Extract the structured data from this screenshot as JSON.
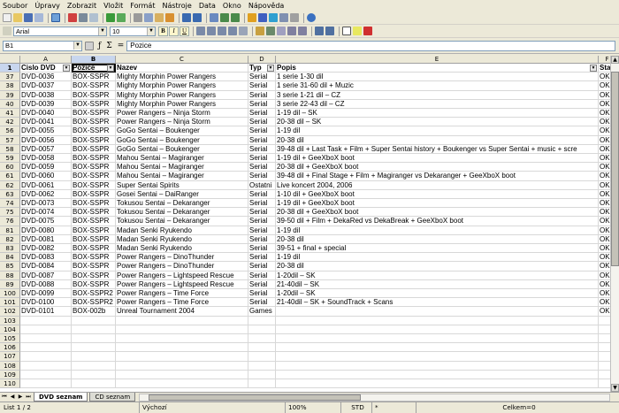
{
  "menu": [
    "Soubor",
    "Úpravy",
    "Zobrazit",
    "Vložit",
    "Formát",
    "Nástroje",
    "Data",
    "Okno",
    "Nápověda"
  ],
  "format_toolbar": {
    "font_name": "Arial",
    "font_size": "10",
    "bold": "B",
    "italic": "I",
    "underline": "U"
  },
  "formula_bar": {
    "cell_ref": "B1",
    "fx_symbol": "ƒ",
    "sum_symbol": "Σ",
    "eq_symbol": "=",
    "content": "Pozice"
  },
  "columns": [
    "A",
    "B",
    "C",
    "D",
    "E",
    "F"
  ],
  "header_row": {
    "row_num": "1",
    "cells": [
      "Cislo DVD",
      "Pozice",
      "Nazev",
      "Typ",
      "Popis",
      "Sta"
    ]
  },
  "rows": [
    {
      "n": "37",
      "c": [
        "DVD-0036",
        "BOX-SSPR",
        "Mighty Morphin Power Rangers",
        "Serial",
        "1 serie 1-30 dil",
        "OK"
      ]
    },
    {
      "n": "38",
      "c": [
        "DVD-0037",
        "BOX-SSPR",
        "Mighty Morphin Power Rangers",
        "Serial",
        "1 serie 31-60 dil + Muzic",
        "OK"
      ]
    },
    {
      "n": "39",
      "c": [
        "DVD-0038",
        "BOX-SSPR",
        "Mighty Morphin Power Rangers",
        "Serial",
        "3 serie 1-21 dil – CZ",
        "OK"
      ]
    },
    {
      "n": "40",
      "c": [
        "DVD-0039",
        "BOX-SSPR",
        "Mighty Morphin Power Rangers",
        "Serial",
        "3 serie 22-43 dil – CZ",
        "OK"
      ]
    },
    {
      "n": "41",
      "c": [
        "DVD-0040",
        "BOX-SSPR",
        "Power Rangers – Ninja Storm",
        "Serial",
        "1-19 dil – SK",
        "OK"
      ]
    },
    {
      "n": "42",
      "c": [
        "DVD-0041",
        "BOX-SSPR",
        "Power Rangers – Ninja Storm",
        "Serial",
        "20-38 dil – SK",
        "OK"
      ]
    },
    {
      "n": "56",
      "c": [
        "DVD-0055",
        "BOX-SSPR",
        "GoGo Sentai – Boukenger",
        "Serial",
        "1-19 dil",
        "OK"
      ]
    },
    {
      "n": "57",
      "c": [
        "DVD-0056",
        "BOX-SSPR",
        "GoGo Sentai – Boukenger",
        "Serial",
        "20-38 dil",
        "OK"
      ]
    },
    {
      "n": "58",
      "c": [
        "DVD-0057",
        "BOX-SSPR",
        "GoGo Sentai – Boukenger",
        "Serial",
        "39-48 dil + Last Task + Film + Super Sentai history + Boukenger vs Super Sentai + music + scre",
        "OK"
      ]
    },
    {
      "n": "59",
      "c": [
        "DVD-0058",
        "BOX-SSPR",
        "Mahou Sentai – Magiranger",
        "Serial",
        "1-19 dil + GeeXboX boot",
        "OK"
      ]
    },
    {
      "n": "60",
      "c": [
        "DVD-0059",
        "BOX-SSPR",
        "Mahou Sentai – Magiranger",
        "Serial",
        "20-38 dil + GeeXboX boot",
        "OK"
      ]
    },
    {
      "n": "61",
      "c": [
        "DVD-0060",
        "BOX-SSPR",
        "Mahou Sentai – Magiranger",
        "Serial",
        "39-48 dil + Final Stage + Film + Magiranger vs Dekaranger + GeeXboX boot",
        "OK"
      ]
    },
    {
      "n": "62",
      "c": [
        "DVD-0061",
        "BOX-SSPR",
        "Super Sentai Spirits",
        "Ostatni",
        "Live koncert 2004, 2006",
        "OK"
      ]
    },
    {
      "n": "63",
      "c": [
        "DVD-0062",
        "BOX-SSPR",
        "Gosei Sentai – DaiRanger",
        "Serial",
        "1-10 dil + GeeXboX boot",
        "OK"
      ]
    },
    {
      "n": "74",
      "c": [
        "DVD-0073",
        "BOX-SSPR",
        "Tokusou Sentai – Dekaranger",
        "Serial",
        "1-19 dil + GeeXboX boot",
        "OK"
      ]
    },
    {
      "n": "75",
      "c": [
        "DVD-0074",
        "BOX-SSPR",
        "Tokusou Sentai – Dekaranger",
        "Serial",
        "20-38 dil + GeeXboX boot",
        "OK"
      ]
    },
    {
      "n": "76",
      "c": [
        "DVD-0075",
        "BOX-SSPR",
        "Tokusou Sentai – Dekaranger",
        "Serial",
        "39-50 dil + Film + DekaRed vs DekaBreak + GeeXboX boot",
        "OK"
      ]
    },
    {
      "n": "81",
      "c": [
        "DVD-0080",
        "BOX-SSPR",
        "Madan Senki Ryukendo",
        "Serial",
        "1-19 dil",
        "OK"
      ]
    },
    {
      "n": "82",
      "c": [
        "DVD-0081",
        "BOX-SSPR",
        "Madan Senki Ryukendo",
        "Serial",
        "20-38 dil",
        "OK"
      ]
    },
    {
      "n": "83",
      "c": [
        "DVD-0082",
        "BOX-SSPR",
        "Madan Senki Ryukendo",
        "Serial",
        "39-51 + final + special",
        "OK"
      ]
    },
    {
      "n": "84",
      "c": [
        "DVD-0083",
        "BOX-SSPR",
        "Power Rangers – DinoThunder",
        "Serial",
        "1-19 dil",
        "OK"
      ]
    },
    {
      "n": "85",
      "c": [
        "DVD-0084",
        "BOX-SSPR",
        "Power Rangers – DinoThunder",
        "Serial",
        "20-38 dil",
        "OK"
      ]
    },
    {
      "n": "88",
      "c": [
        "DVD-0087",
        "BOX-SSPR",
        "Power Rangers – Lightspeed Rescue",
        "Serial",
        "1-20dil – SK",
        "OK"
      ]
    },
    {
      "n": "89",
      "c": [
        "DVD-0088",
        "BOX-SSPR",
        "Power Rangers – Lightspeed Rescue",
        "Serial",
        "21-40dil – SK",
        "OK"
      ]
    },
    {
      "n": "100",
      "c": [
        "DVD-0099",
        "BOX-SSPR2",
        "Power Rangers – Time Force",
        "Serial",
        "1-20dil – SK",
        "OK"
      ]
    },
    {
      "n": "101",
      "c": [
        "DVD-0100",
        "BOX-SSPR2",
        "Power Rangers – Time Force",
        "Serial",
        "21-40dil – SK + SoundTrack + Scans",
        "OK"
      ]
    },
    {
      "n": "102",
      "c": [
        "DVD-0101",
        "BOX-002b",
        "Unreal Tournament 2004",
        "Games",
        "",
        "OK"
      ]
    },
    {
      "n": "103",
      "c": [
        "",
        "",
        "",
        "",
        "",
        ""
      ]
    },
    {
      "n": "104",
      "c": [
        "",
        "",
        "",
        "",
        "",
        ""
      ]
    },
    {
      "n": "105",
      "c": [
        "",
        "",
        "",
        "",
        "",
        ""
      ]
    },
    {
      "n": "106",
      "c": [
        "",
        "",
        "",
        "",
        "",
        ""
      ]
    },
    {
      "n": "107",
      "c": [
        "",
        "",
        "",
        "",
        "",
        ""
      ]
    },
    {
      "n": "108",
      "c": [
        "",
        "",
        "",
        "",
        "",
        ""
      ]
    },
    {
      "n": "109",
      "c": [
        "",
        "",
        "",
        "",
        "",
        ""
      ]
    },
    {
      "n": "110",
      "c": [
        "",
        "",
        "",
        "",
        "",
        ""
      ]
    }
  ],
  "sheet_tabs": [
    {
      "label": "DVD seznam",
      "active": true
    },
    {
      "label": "CD seznam",
      "active": false
    }
  ],
  "status": {
    "sheet": "List 1 / 2",
    "style": "Výchozí",
    "zoom": "100%",
    "mode": "STD",
    "modified": "*",
    "sum": "Celkem=0"
  },
  "colors": {
    "chrome": "#ece9d8",
    "selection_header": "#c8d6ee",
    "grid_line": "#d8d8d8"
  }
}
